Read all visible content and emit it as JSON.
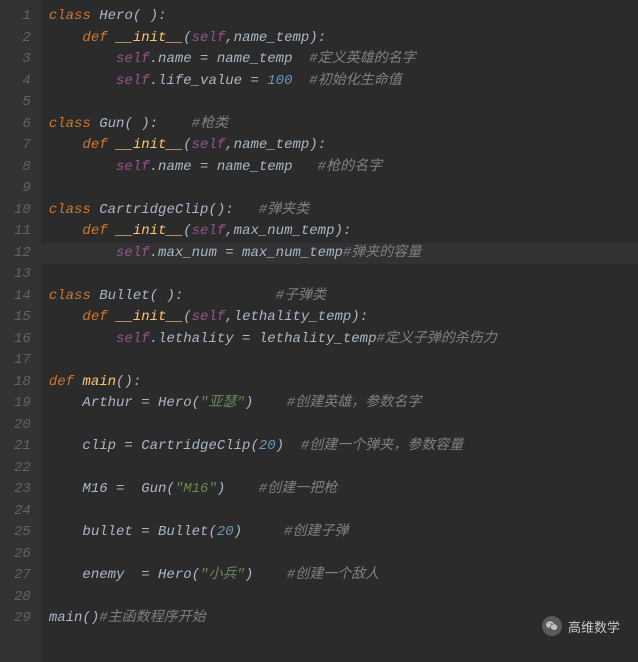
{
  "chart_data": null,
  "editor": {
    "current_line": 12,
    "lines": [
      {
        "n": 1,
        "tokens": [
          {
            "t": "class ",
            "c": "kw"
          },
          {
            "t": "Hero",
            "c": "classname"
          },
          {
            "t": "( ):",
            "c": "paren"
          }
        ]
      },
      {
        "n": 2,
        "tokens": [
          {
            "t": "    ",
            "c": ""
          },
          {
            "t": "def ",
            "c": "kw"
          },
          {
            "t": "__init__",
            "c": "fn"
          },
          {
            "t": "(",
            "c": "paren"
          },
          {
            "t": "self",
            "c": "self"
          },
          {
            "t": ",",
            "c": "op"
          },
          {
            "t": "name_temp",
            "c": "param"
          },
          {
            "t": "):",
            "c": "paren"
          }
        ]
      },
      {
        "n": 3,
        "tokens": [
          {
            "t": "        ",
            "c": ""
          },
          {
            "t": "self",
            "c": "self"
          },
          {
            "t": ".name = name_temp  ",
            "c": "ident"
          },
          {
            "t": "#定义英雄的名字",
            "c": "cmt"
          }
        ]
      },
      {
        "n": 4,
        "tokens": [
          {
            "t": "        ",
            "c": ""
          },
          {
            "t": "self",
            "c": "self"
          },
          {
            "t": ".life_value = ",
            "c": "ident"
          },
          {
            "t": "100",
            "c": "num"
          },
          {
            "t": "  ",
            "c": ""
          },
          {
            "t": "#初始化生命值",
            "c": "cmt"
          }
        ]
      },
      {
        "n": 5,
        "tokens": []
      },
      {
        "n": 6,
        "tokens": [
          {
            "t": "class ",
            "c": "kw"
          },
          {
            "t": "Gun",
            "c": "classname"
          },
          {
            "t": "( ):    ",
            "c": "paren"
          },
          {
            "t": "#枪类",
            "c": "cmt"
          }
        ]
      },
      {
        "n": 7,
        "tokens": [
          {
            "t": "    ",
            "c": ""
          },
          {
            "t": "def ",
            "c": "kw"
          },
          {
            "t": "__init__",
            "c": "fn"
          },
          {
            "t": "(",
            "c": "paren"
          },
          {
            "t": "self",
            "c": "self"
          },
          {
            "t": ",",
            "c": "op"
          },
          {
            "t": "name_temp",
            "c": "param"
          },
          {
            "t": "):",
            "c": "paren"
          }
        ]
      },
      {
        "n": 8,
        "tokens": [
          {
            "t": "        ",
            "c": ""
          },
          {
            "t": "self",
            "c": "self"
          },
          {
            "t": ".name = name_temp   ",
            "c": "ident"
          },
          {
            "t": "#枪的名字",
            "c": "cmt"
          }
        ]
      },
      {
        "n": 9,
        "tokens": []
      },
      {
        "n": 10,
        "tokens": [
          {
            "t": "class ",
            "c": "kw"
          },
          {
            "t": "CartridgeClip",
            "c": "classname"
          },
          {
            "t": "():   ",
            "c": "paren"
          },
          {
            "t": "#弹夹类",
            "c": "cmt"
          }
        ]
      },
      {
        "n": 11,
        "tokens": [
          {
            "t": "    ",
            "c": ""
          },
          {
            "t": "def ",
            "c": "kw"
          },
          {
            "t": "__init__",
            "c": "fn"
          },
          {
            "t": "(",
            "c": "paren"
          },
          {
            "t": "self",
            "c": "self"
          },
          {
            "t": ",",
            "c": "op"
          },
          {
            "t": "max_num_temp",
            "c": "param"
          },
          {
            "t": "):",
            "c": "paren"
          }
        ]
      },
      {
        "n": 12,
        "tokens": [
          {
            "t": "        ",
            "c": ""
          },
          {
            "t": "self",
            "c": "self"
          },
          {
            "t": ".max_num = max_num_temp",
            "c": "ident"
          },
          {
            "t": "#弹夹的容量",
            "c": "cmt"
          }
        ]
      },
      {
        "n": 13,
        "tokens": []
      },
      {
        "n": 14,
        "tokens": [
          {
            "t": "class ",
            "c": "kw"
          },
          {
            "t": "Bullet",
            "c": "classname"
          },
          {
            "t": "( ):           ",
            "c": "paren"
          },
          {
            "t": "#子弹类",
            "c": "cmt"
          }
        ]
      },
      {
        "n": 15,
        "tokens": [
          {
            "t": "    ",
            "c": ""
          },
          {
            "t": "def ",
            "c": "kw"
          },
          {
            "t": "__init__",
            "c": "fn"
          },
          {
            "t": "(",
            "c": "paren"
          },
          {
            "t": "self",
            "c": "self"
          },
          {
            "t": ",",
            "c": "op"
          },
          {
            "t": "lethality_temp",
            "c": "param"
          },
          {
            "t": "):",
            "c": "paren"
          }
        ]
      },
      {
        "n": 16,
        "tokens": [
          {
            "t": "        ",
            "c": ""
          },
          {
            "t": "self",
            "c": "self"
          },
          {
            "t": ".lethality = lethality_temp",
            "c": "ident"
          },
          {
            "t": "#定义子弹的杀伤力",
            "c": "cmt"
          }
        ]
      },
      {
        "n": 17,
        "tokens": []
      },
      {
        "n": 18,
        "tokens": [
          {
            "t": "def ",
            "c": "kw"
          },
          {
            "t": "main",
            "c": "fn"
          },
          {
            "t": "():",
            "c": "paren"
          }
        ]
      },
      {
        "n": 19,
        "tokens": [
          {
            "t": "    Arthur = Hero(",
            "c": "ident"
          },
          {
            "t": "\"亚瑟\"",
            "c": "str"
          },
          {
            "t": ")    ",
            "c": "ident"
          },
          {
            "t": "#创建英雄，参数名字",
            "c": "cmt"
          }
        ]
      },
      {
        "n": 20,
        "tokens": []
      },
      {
        "n": 21,
        "tokens": [
          {
            "t": "    clip = CartridgeClip(",
            "c": "ident"
          },
          {
            "t": "20",
            "c": "num"
          },
          {
            "t": ")  ",
            "c": "ident"
          },
          {
            "t": "#创建一个弹夹，参数容量",
            "c": "cmt"
          }
        ]
      },
      {
        "n": 22,
        "tokens": []
      },
      {
        "n": 23,
        "tokens": [
          {
            "t": "    M16 =  Gun(",
            "c": "ident"
          },
          {
            "t": "\"M16\"",
            "c": "str"
          },
          {
            "t": ")    ",
            "c": "ident"
          },
          {
            "t": "#创建一把枪",
            "c": "cmt"
          }
        ]
      },
      {
        "n": 24,
        "tokens": []
      },
      {
        "n": 25,
        "tokens": [
          {
            "t": "    bullet = Bullet(",
            "c": "ident"
          },
          {
            "t": "20",
            "c": "num"
          },
          {
            "t": ")     ",
            "c": "ident"
          },
          {
            "t": "#创建子弹",
            "c": "cmt"
          }
        ]
      },
      {
        "n": 26,
        "tokens": []
      },
      {
        "n": 27,
        "tokens": [
          {
            "t": "    enemy  = Hero(",
            "c": "ident"
          },
          {
            "t": "\"小兵\"",
            "c": "str"
          },
          {
            "t": ")    ",
            "c": "ident"
          },
          {
            "t": "#创建一个敌人",
            "c": "cmt"
          }
        ]
      },
      {
        "n": 28,
        "tokens": []
      },
      {
        "n": 29,
        "tokens": [
          {
            "t": "main()",
            "c": "ident"
          },
          {
            "t": "#主函数程序开始",
            "c": "cmt"
          }
        ]
      }
    ]
  },
  "watermark": {
    "text": "高维数学"
  }
}
